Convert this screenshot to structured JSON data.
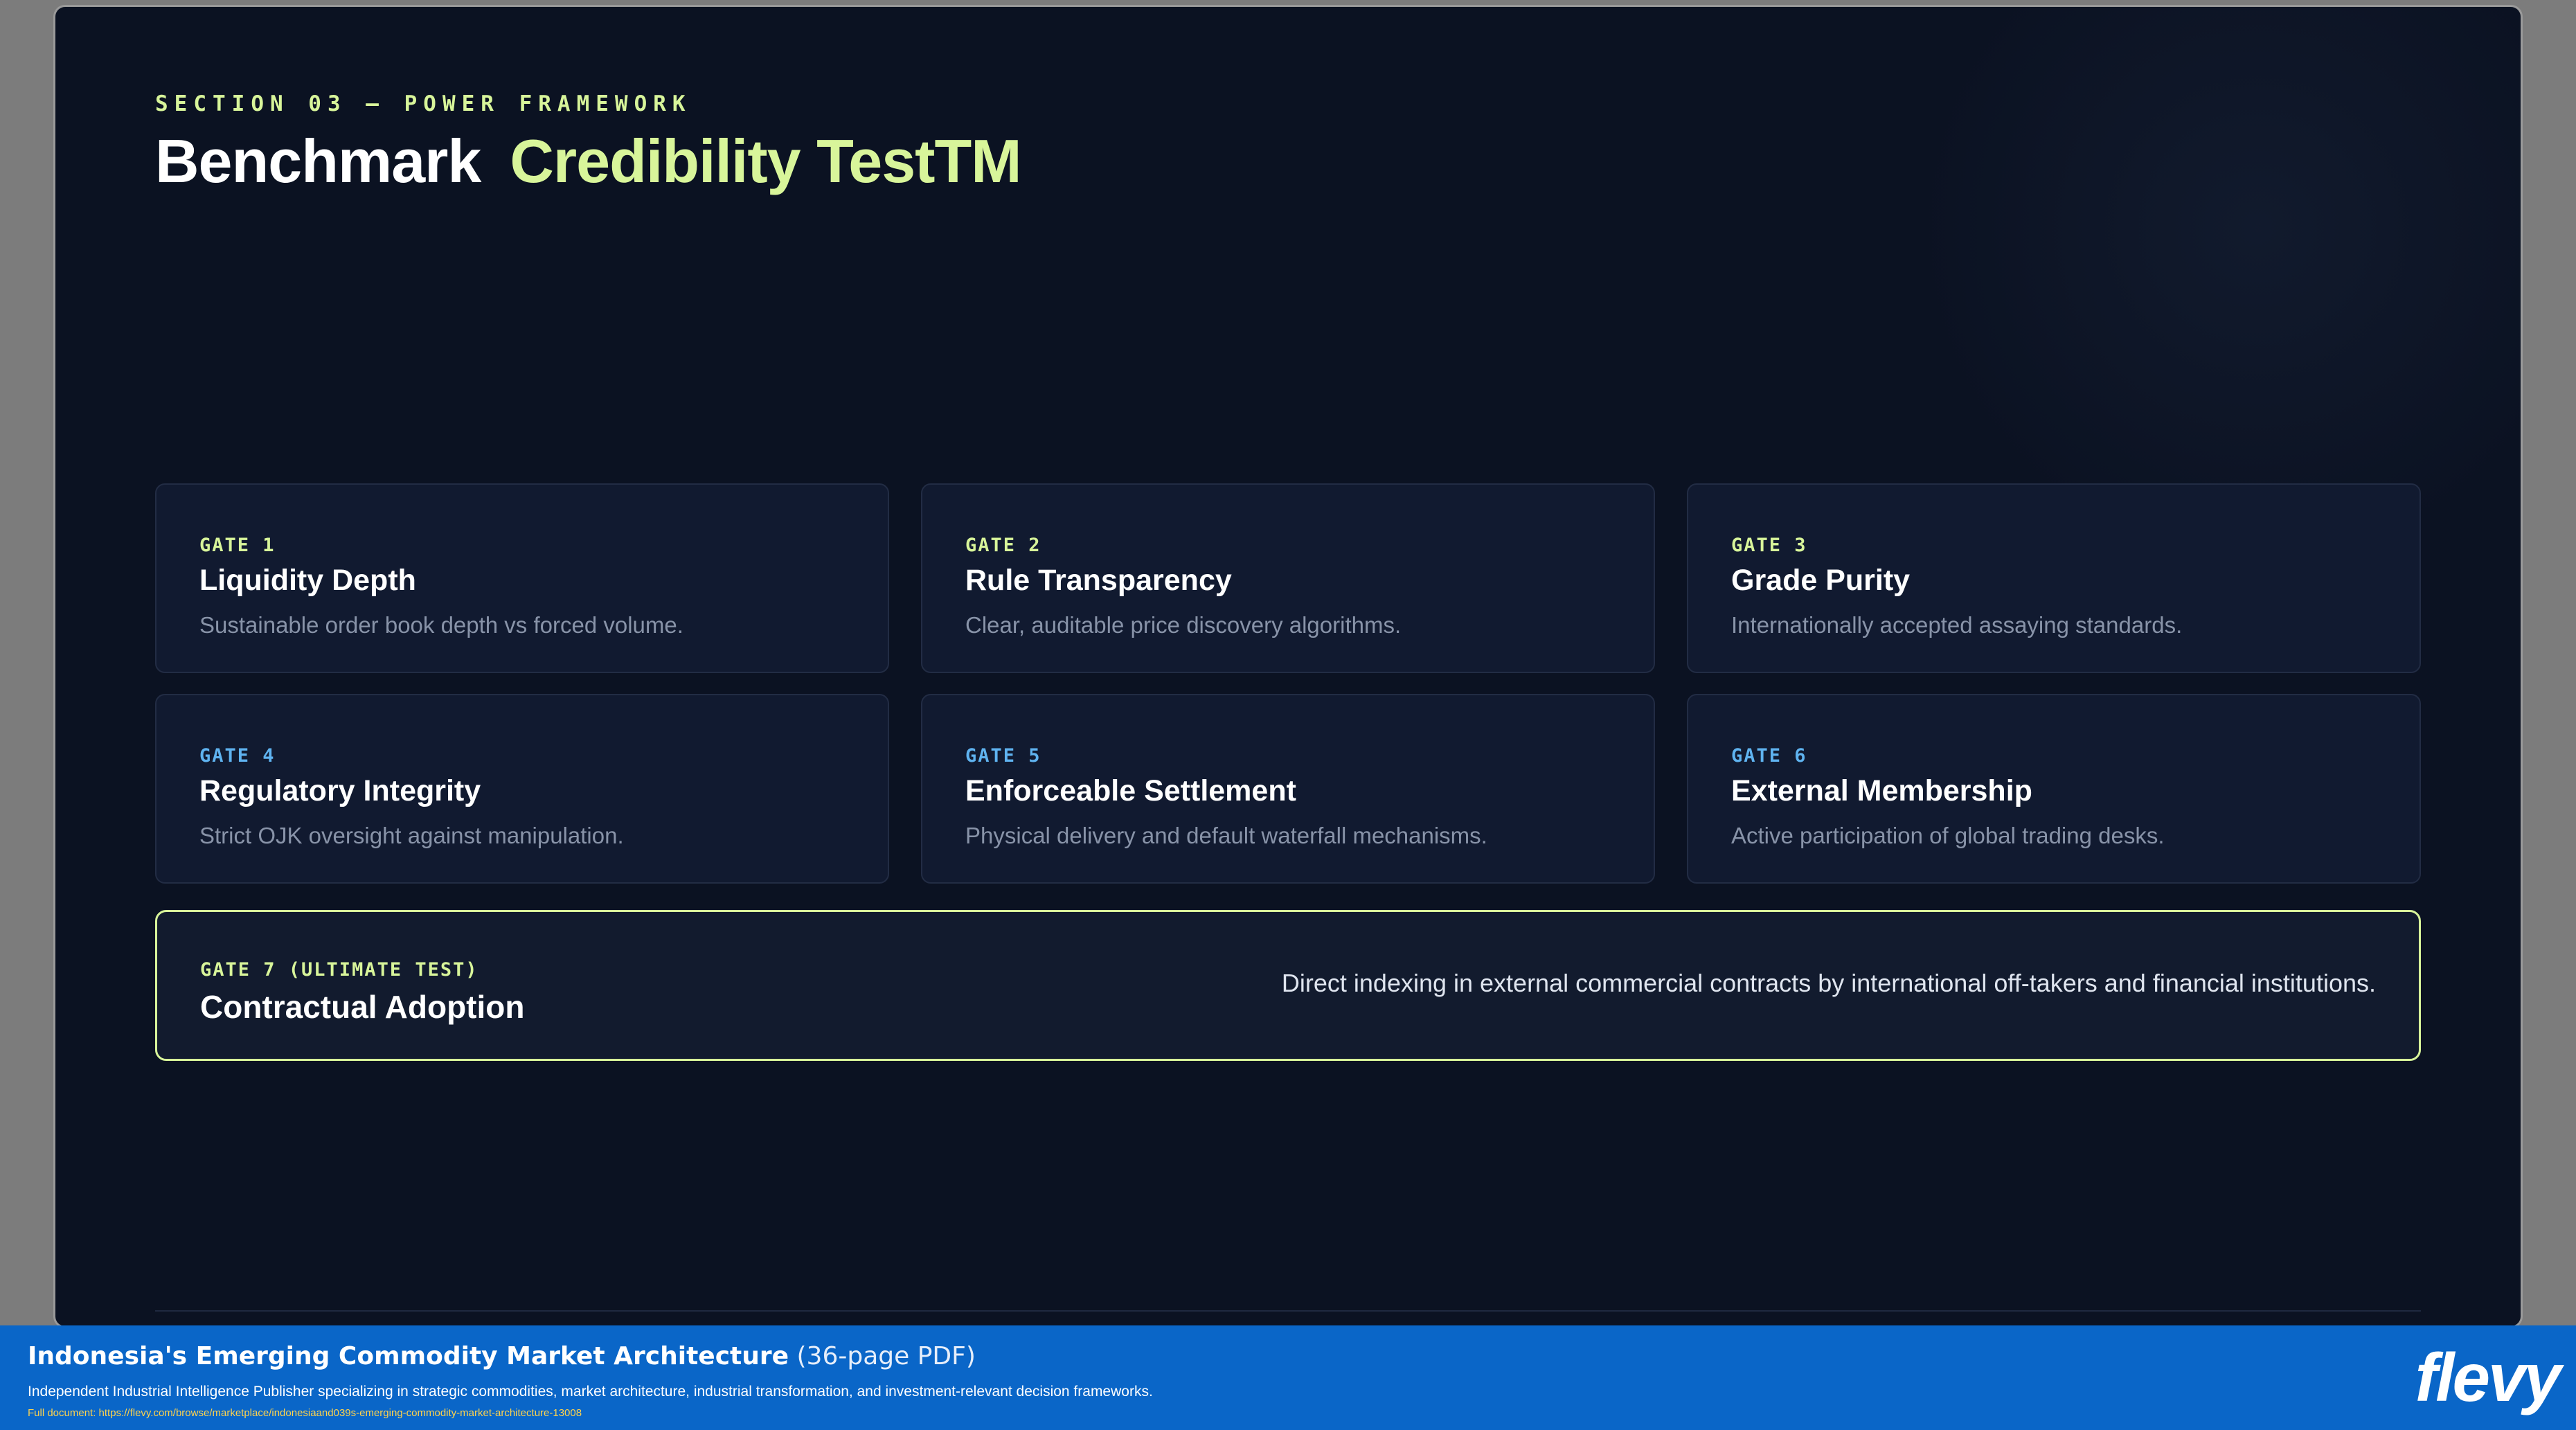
{
  "slide": {
    "eyebrow": "SECTION 03 — POWER FRAMEWORK",
    "title_main": "Benchmark",
    "title_accent": "Credibility TestTM",
    "gates": [
      {
        "label": "GATE 1",
        "name": "Liquidity Depth",
        "desc": "Sustainable order book depth vs forced volume.",
        "color": "#d8f59a"
      },
      {
        "label": "GATE 2",
        "name": "Rule Transparency",
        "desc": "Clear, auditable price discovery algorithms.",
        "color": "#d8f59a"
      },
      {
        "label": "GATE 3",
        "name": "Grade Purity",
        "desc": "Internationally accepted assaying standards.",
        "color": "#d8f59a"
      },
      {
        "label": "GATE 4",
        "name": "Regulatory Integrity",
        "desc": "Strict OJK oversight against manipulation.",
        "color": "#5fb3f0"
      },
      {
        "label": "GATE 5",
        "name": "Enforceable Settlement",
        "desc": "Physical delivery and default waterfall mechanisms.",
        "color": "#5fb3f0"
      },
      {
        "label": "GATE 6",
        "name": "External Membership",
        "desc": "Active participation of global trading desks.",
        "color": "#5fb3f0"
      }
    ],
    "final_gate": {
      "label": "GATE 7 (ULTIMATE TEST)",
      "name": "Contractual Adoption",
      "desc": "Direct indexing in external commercial contracts by international off-takers and financial institutions."
    }
  },
  "banner": {
    "doc_title": "Indonesia's Emerging Commodity Market Architecture",
    "pages": "(36-page PDF)",
    "tagline": "Independent Industrial Intelligence Publisher specializing in strategic commodities, market architecture, industrial transformation, and investment-relevant decision frameworks.",
    "link": "Full document: https://flevy.com/browse/marketplace/indonesiaand039s-emerging-commodity-market-architecture-13008",
    "logo": "flevy"
  }
}
